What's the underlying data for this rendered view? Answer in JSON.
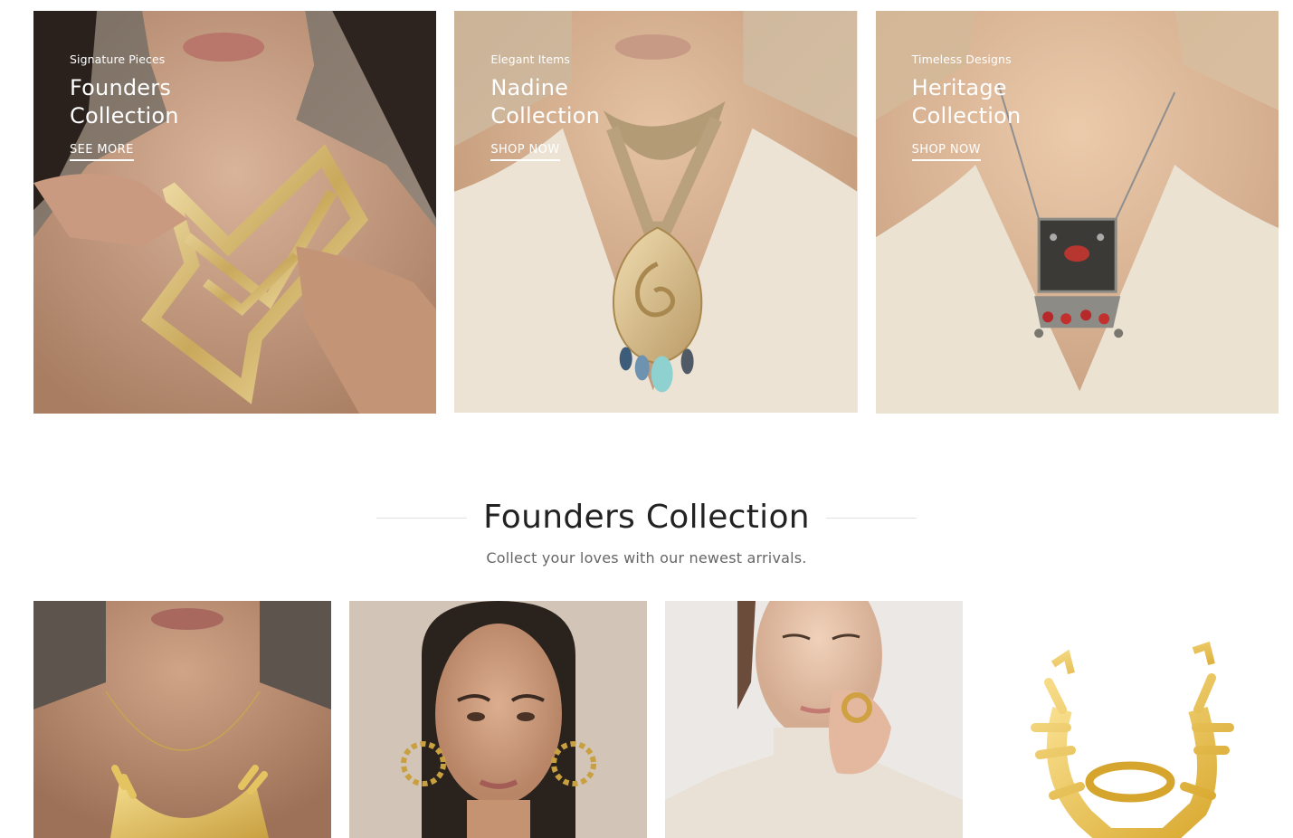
{
  "banners": [
    {
      "subtitle": "Signature Pieces",
      "title": "Founders Collection",
      "link": "SEE MORE",
      "bg_color": "#8b7d70",
      "jewelry": "geometric-gold-collar"
    },
    {
      "subtitle": "Elegant Items",
      "title": "Nadine Collection",
      "link": "SHOP NOW",
      "bg_color": "#cdb79a",
      "jewelry": "swirl-pendant-with-gems"
    },
    {
      "subtitle": "Timeless Designs",
      "title": "Heritage Collection",
      "link": "SHOP NOW",
      "bg_color": "#d6bc9c",
      "jewelry": "silver-coin-pendant"
    }
  ],
  "section": {
    "title": "Founders Collection",
    "subtitle": "Collect your loves with our newest arrivals."
  },
  "products": [
    {
      "image": "gold-coral-necklace",
      "bg_color": "#5e554e"
    },
    {
      "image": "gold-hoop-earrings",
      "bg_color": "#d3c6b9"
    },
    {
      "image": "gold-ring-on-hand",
      "bg_color": "#ece9e6"
    },
    {
      "image": "gold-coral-cuff-ring",
      "bg_color": "#ffffff"
    }
  ]
}
